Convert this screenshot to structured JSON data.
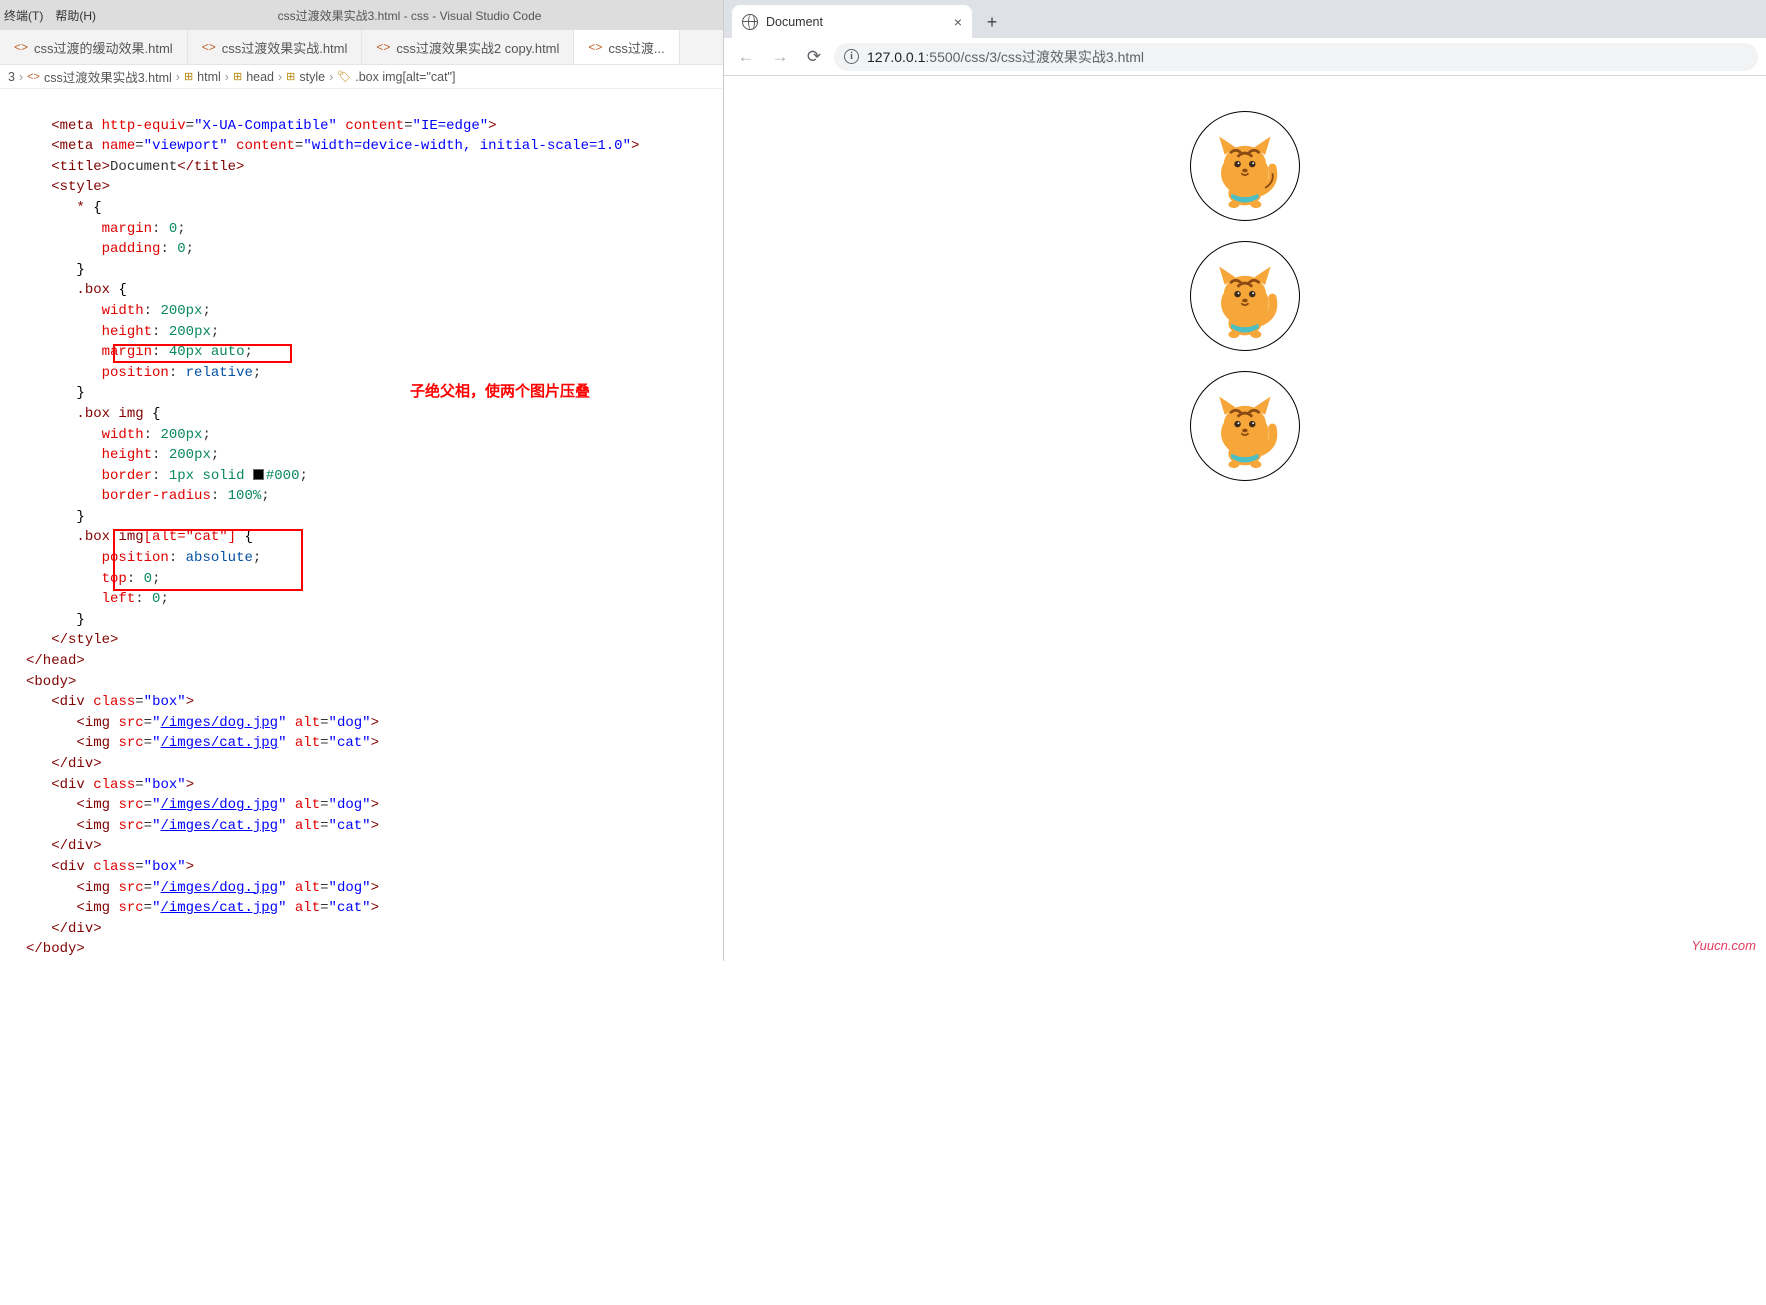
{
  "vscode": {
    "menus": [
      "终端(T)",
      "帮助(H)"
    ],
    "title": "css过渡效果实战3.html - css - Visual Studio Code",
    "tabs": [
      {
        "label": "css过渡的缓动效果.html",
        "active": false
      },
      {
        "label": "css过渡效果实战.html",
        "active": false
      },
      {
        "label": "css过渡效果实战2 copy.html",
        "active": false
      },
      {
        "label": "css过渡...",
        "active": true
      }
    ],
    "breadcrumbs": [
      "3",
      "css过渡效果实战3.html",
      "html",
      "head",
      "style",
      ".box img[alt=\"cat\"]"
    ],
    "annotation": "子绝父相，使两个图片压叠",
    "code": {
      "meta1": {
        "attr1": "http-equiv",
        "val1": "X-UA-Compatible",
        "attr2": "content",
        "val2": "IE=edge"
      },
      "meta2": {
        "attr1": "name",
        "val1": "viewport",
        "attr2": "content",
        "val2": "width=device-width, initial-scale=1.0"
      },
      "title_text": "Document",
      "sel_star": "*",
      "sel_box": ".box",
      "sel_boximg": ".box img",
      "sel_boxcat": {
        "base": ".box img",
        "attr": "[alt=\"cat\"]"
      },
      "props": {
        "margin0": "0",
        "padding0": "0",
        "w200": "200px",
        "h200": "200px",
        "margin40": "40px auto",
        "posrel": "relative",
        "border": "1px solid ",
        "bordercolor": "#000",
        "bradius": "100%",
        "posabs": "absolute",
        "top0": "0",
        "left0": "0"
      },
      "div_class": "box",
      "img_dog": {
        "src": "/imges/dog.jpg",
        "alt": "dog"
      },
      "img_cat": {
        "src": "/imges/cat.jpg",
        "alt": "cat"
      }
    }
  },
  "browser": {
    "tab_title": "Document",
    "url_host": "127.0.0.1",
    "url_port": ":5500",
    "url_path": "/css/3/css过渡效果实战3.html",
    "watermark": "Yuucn.com"
  }
}
